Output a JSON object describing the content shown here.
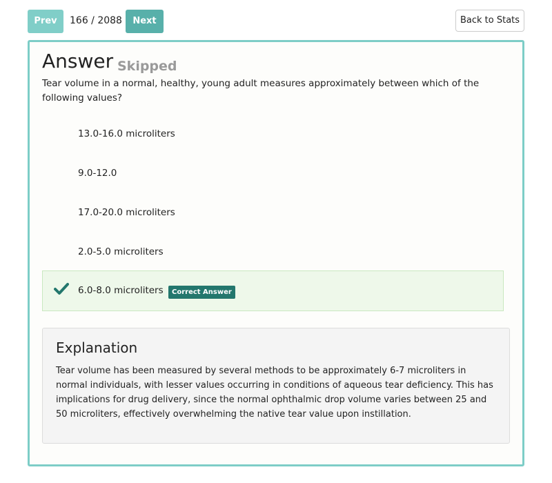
{
  "nav": {
    "prev_label": "Prev",
    "counter": "166 / 2088",
    "next_label": "Next",
    "back_label": "Back to Stats"
  },
  "answer": {
    "heading": "Answer",
    "status": "Skipped"
  },
  "question": {
    "text": "Tear volume in a normal, healthy, young adult measures approximately between which of the following values?"
  },
  "options": [
    {
      "label": "13.0-16.0 microliters"
    },
    {
      "label": "9.0-12.0"
    },
    {
      "label": "17.0-20.0 microliters"
    },
    {
      "label": "2.0-5.0 microliters"
    },
    {
      "label": "6.0-8.0 microliters",
      "badge": "Correct Answer",
      "icon": "checkmark-icon"
    }
  ],
  "explanation": {
    "heading": "Explanation",
    "body": "Tear volume has been measured by several methods to be approximately 6-7 microliters in normal individuals, with lesser values occurring in conditions of aqueous tear deficiency. This has implications for drug delivery, since the normal ophthalmic drop volume varies between 25 and 50 microliters, effectively overwhelming the native tear value upon instillation."
  },
  "colors": {
    "accent": "#58b0aa",
    "accent_light": "#80cec8",
    "panel_border": "#7dcdc7",
    "correct_bg": "#eef8ea",
    "badge": "#23776d",
    "status_gray": "#9a9a9a"
  }
}
